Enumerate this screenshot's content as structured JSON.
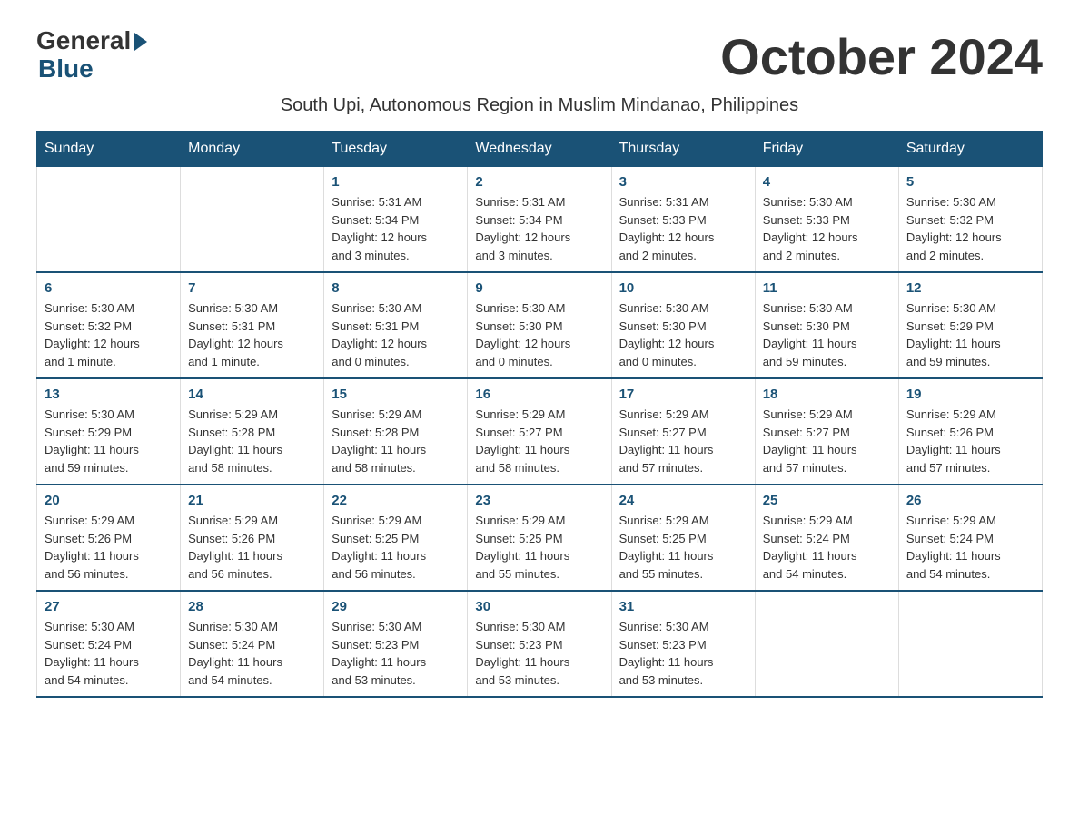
{
  "logo": {
    "general": "General",
    "blue": "Blue"
  },
  "title": "October 2024",
  "subtitle": "South Upi, Autonomous Region in Muslim Mindanao, Philippines",
  "weekdays": [
    "Sunday",
    "Monday",
    "Tuesday",
    "Wednesday",
    "Thursday",
    "Friday",
    "Saturday"
  ],
  "weeks": [
    [
      {
        "day": "",
        "info": ""
      },
      {
        "day": "",
        "info": ""
      },
      {
        "day": "1",
        "info": "Sunrise: 5:31 AM\nSunset: 5:34 PM\nDaylight: 12 hours\nand 3 minutes."
      },
      {
        "day": "2",
        "info": "Sunrise: 5:31 AM\nSunset: 5:34 PM\nDaylight: 12 hours\nand 3 minutes."
      },
      {
        "day": "3",
        "info": "Sunrise: 5:31 AM\nSunset: 5:33 PM\nDaylight: 12 hours\nand 2 minutes."
      },
      {
        "day": "4",
        "info": "Sunrise: 5:30 AM\nSunset: 5:33 PM\nDaylight: 12 hours\nand 2 minutes."
      },
      {
        "day": "5",
        "info": "Sunrise: 5:30 AM\nSunset: 5:32 PM\nDaylight: 12 hours\nand 2 minutes."
      }
    ],
    [
      {
        "day": "6",
        "info": "Sunrise: 5:30 AM\nSunset: 5:32 PM\nDaylight: 12 hours\nand 1 minute."
      },
      {
        "day": "7",
        "info": "Sunrise: 5:30 AM\nSunset: 5:31 PM\nDaylight: 12 hours\nand 1 minute."
      },
      {
        "day": "8",
        "info": "Sunrise: 5:30 AM\nSunset: 5:31 PM\nDaylight: 12 hours\nand 0 minutes."
      },
      {
        "day": "9",
        "info": "Sunrise: 5:30 AM\nSunset: 5:30 PM\nDaylight: 12 hours\nand 0 minutes."
      },
      {
        "day": "10",
        "info": "Sunrise: 5:30 AM\nSunset: 5:30 PM\nDaylight: 12 hours\nand 0 minutes."
      },
      {
        "day": "11",
        "info": "Sunrise: 5:30 AM\nSunset: 5:30 PM\nDaylight: 11 hours\nand 59 minutes."
      },
      {
        "day": "12",
        "info": "Sunrise: 5:30 AM\nSunset: 5:29 PM\nDaylight: 11 hours\nand 59 minutes."
      }
    ],
    [
      {
        "day": "13",
        "info": "Sunrise: 5:30 AM\nSunset: 5:29 PM\nDaylight: 11 hours\nand 59 minutes."
      },
      {
        "day": "14",
        "info": "Sunrise: 5:29 AM\nSunset: 5:28 PM\nDaylight: 11 hours\nand 58 minutes."
      },
      {
        "day": "15",
        "info": "Sunrise: 5:29 AM\nSunset: 5:28 PM\nDaylight: 11 hours\nand 58 minutes."
      },
      {
        "day": "16",
        "info": "Sunrise: 5:29 AM\nSunset: 5:27 PM\nDaylight: 11 hours\nand 58 minutes."
      },
      {
        "day": "17",
        "info": "Sunrise: 5:29 AM\nSunset: 5:27 PM\nDaylight: 11 hours\nand 57 minutes."
      },
      {
        "day": "18",
        "info": "Sunrise: 5:29 AM\nSunset: 5:27 PM\nDaylight: 11 hours\nand 57 minutes."
      },
      {
        "day": "19",
        "info": "Sunrise: 5:29 AM\nSunset: 5:26 PM\nDaylight: 11 hours\nand 57 minutes."
      }
    ],
    [
      {
        "day": "20",
        "info": "Sunrise: 5:29 AM\nSunset: 5:26 PM\nDaylight: 11 hours\nand 56 minutes."
      },
      {
        "day": "21",
        "info": "Sunrise: 5:29 AM\nSunset: 5:26 PM\nDaylight: 11 hours\nand 56 minutes."
      },
      {
        "day": "22",
        "info": "Sunrise: 5:29 AM\nSunset: 5:25 PM\nDaylight: 11 hours\nand 56 minutes."
      },
      {
        "day": "23",
        "info": "Sunrise: 5:29 AM\nSunset: 5:25 PM\nDaylight: 11 hours\nand 55 minutes."
      },
      {
        "day": "24",
        "info": "Sunrise: 5:29 AM\nSunset: 5:25 PM\nDaylight: 11 hours\nand 55 minutes."
      },
      {
        "day": "25",
        "info": "Sunrise: 5:29 AM\nSunset: 5:24 PM\nDaylight: 11 hours\nand 54 minutes."
      },
      {
        "day": "26",
        "info": "Sunrise: 5:29 AM\nSunset: 5:24 PM\nDaylight: 11 hours\nand 54 minutes."
      }
    ],
    [
      {
        "day": "27",
        "info": "Sunrise: 5:30 AM\nSunset: 5:24 PM\nDaylight: 11 hours\nand 54 minutes."
      },
      {
        "day": "28",
        "info": "Sunrise: 5:30 AM\nSunset: 5:24 PM\nDaylight: 11 hours\nand 54 minutes."
      },
      {
        "day": "29",
        "info": "Sunrise: 5:30 AM\nSunset: 5:23 PM\nDaylight: 11 hours\nand 53 minutes."
      },
      {
        "day": "30",
        "info": "Sunrise: 5:30 AM\nSunset: 5:23 PM\nDaylight: 11 hours\nand 53 minutes."
      },
      {
        "day": "31",
        "info": "Sunrise: 5:30 AM\nSunset: 5:23 PM\nDaylight: 11 hours\nand 53 minutes."
      },
      {
        "day": "",
        "info": ""
      },
      {
        "day": "",
        "info": ""
      }
    ]
  ]
}
